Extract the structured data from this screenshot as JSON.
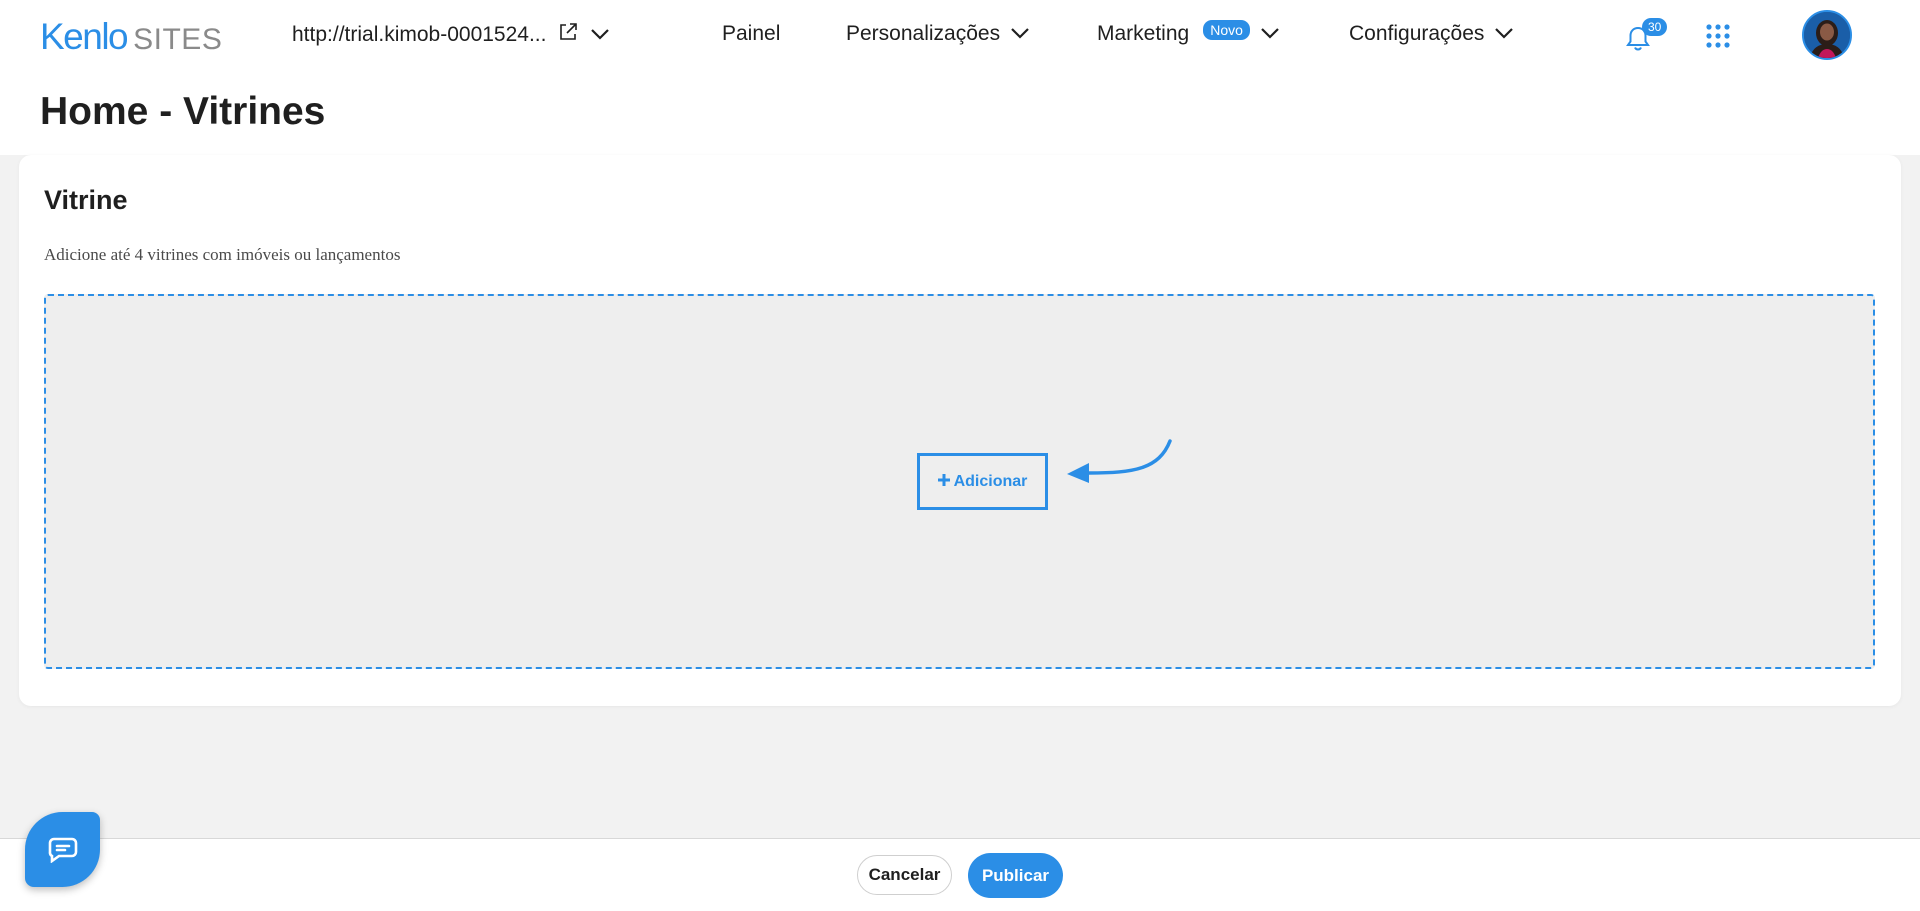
{
  "colors": {
    "accent": "#2b8ee6",
    "logo_grey": "#8a8a8a",
    "dropzone_bg": "#eeeeee"
  },
  "header": {
    "logo": {
      "brand": "Kenlo",
      "product": "SITES"
    },
    "site_url": "http://trial.kimob-0001524...",
    "nav": {
      "painel": "Painel",
      "personalizacoes": "Personalizações",
      "marketing": "Marketing",
      "marketing_badge": "Novo",
      "configuracoes": "Configurações"
    },
    "notifications_count": "30"
  },
  "page": {
    "title": "Home - Vitrines"
  },
  "card": {
    "title": "Vitrine",
    "description": "Adicione até 4 vitrines com imóveis ou lançamentos",
    "add_button": "Adicionar"
  },
  "footer": {
    "cancel_label": "Cancelar",
    "publish_label": "Publicar"
  }
}
